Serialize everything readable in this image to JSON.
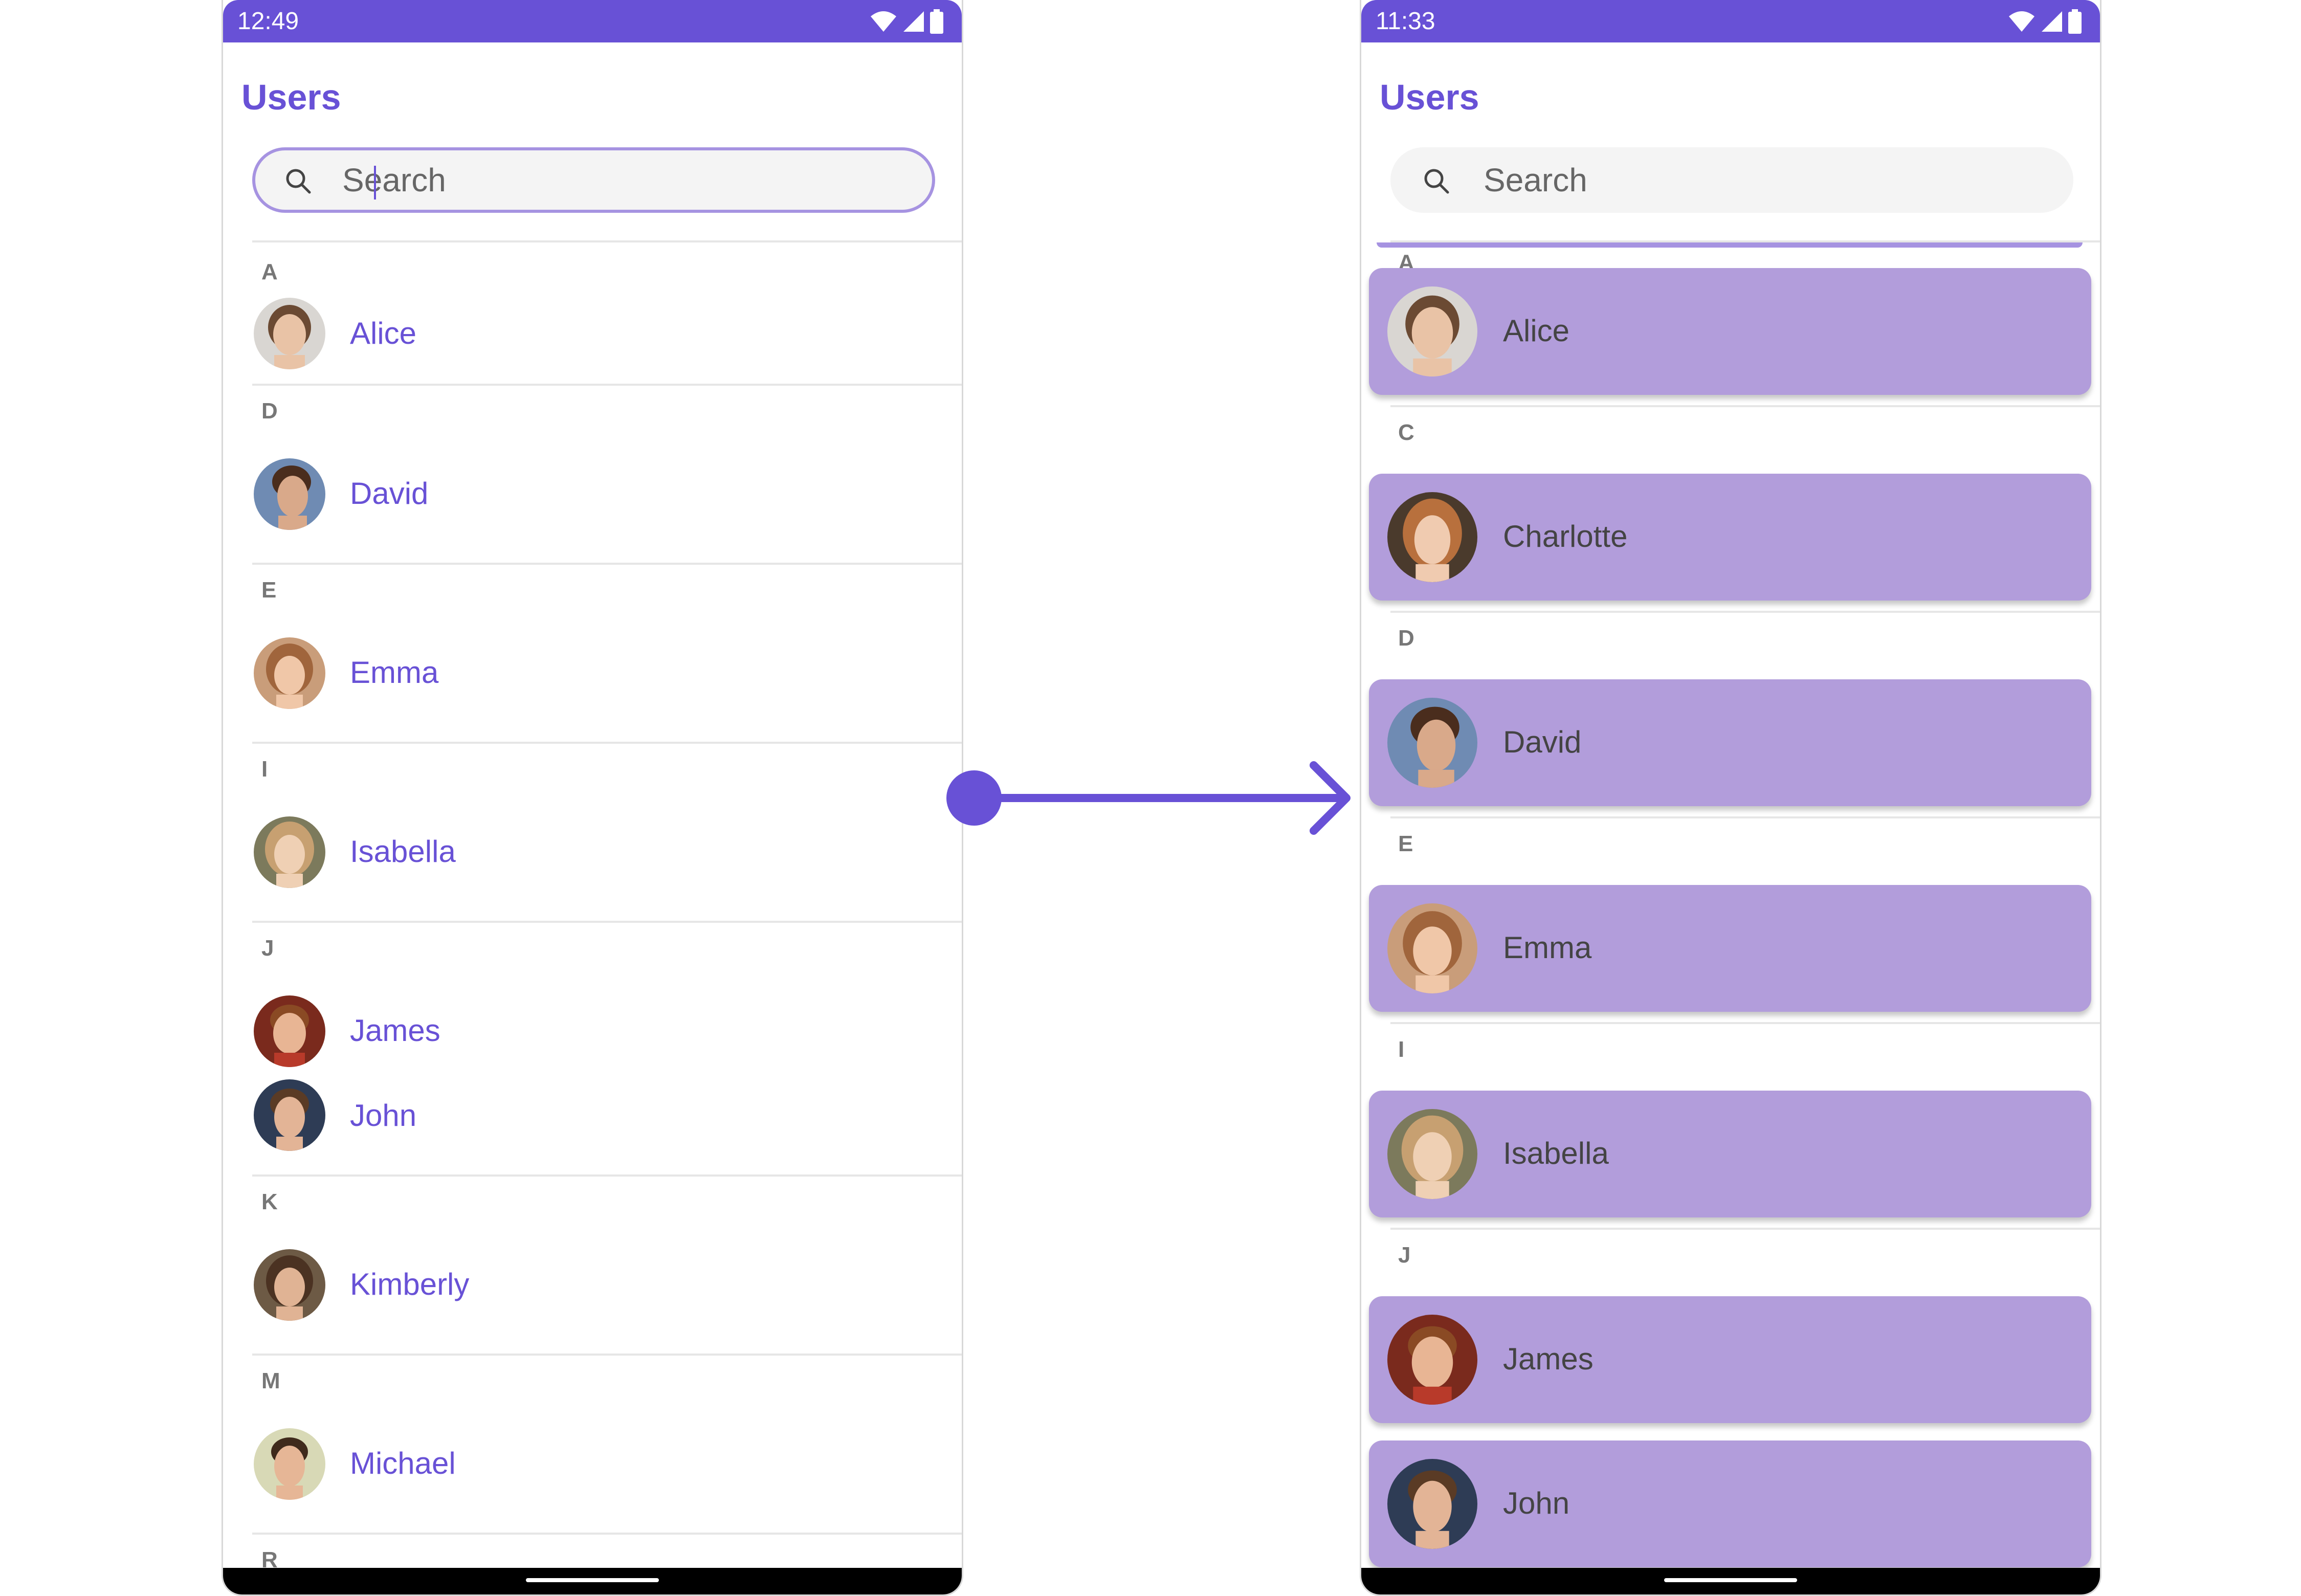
{
  "colors": {
    "accent": "#6851d6",
    "card": "#b29ddb",
    "divider": "#e6e6e6",
    "letter": "#777777"
  },
  "left_screen": {
    "status_time": "12:49",
    "title": "Users",
    "search": {
      "placeholder": "Search",
      "focused": true
    },
    "sections": [
      {
        "letter": "A",
        "users": [
          {
            "name": "Alice",
            "avatar": "avatar-alice"
          }
        ]
      },
      {
        "letter": "D",
        "users": [
          {
            "name": "David",
            "avatar": "avatar-david"
          }
        ]
      },
      {
        "letter": "E",
        "users": [
          {
            "name": "Emma",
            "avatar": "avatar-emma"
          }
        ]
      },
      {
        "letter": "I",
        "users": [
          {
            "name": "Isabella",
            "avatar": "avatar-isabella"
          }
        ]
      },
      {
        "letter": "J",
        "users": [
          {
            "name": "James",
            "avatar": "avatar-james"
          },
          {
            "name": "John",
            "avatar": "avatar-john"
          }
        ]
      },
      {
        "letter": "K",
        "users": [
          {
            "name": "Kimberly",
            "avatar": "avatar-kimberly"
          }
        ]
      },
      {
        "letter": "M",
        "users": [
          {
            "name": "Michael",
            "avatar": "avatar-michael"
          }
        ]
      },
      {
        "letter": "R",
        "users": []
      }
    ]
  },
  "right_screen": {
    "status_time": "11:33",
    "title": "Users",
    "search": {
      "placeholder": "Search",
      "focused": false
    },
    "sections": [
      {
        "letter": "A",
        "users": [
          {
            "name": "Alice",
            "avatar": "avatar-alice"
          }
        ]
      },
      {
        "letter": "C",
        "users": [
          {
            "name": "Charlotte",
            "avatar": "avatar-charlotte"
          }
        ]
      },
      {
        "letter": "D",
        "users": [
          {
            "name": "David",
            "avatar": "avatar-david"
          }
        ]
      },
      {
        "letter": "E",
        "users": [
          {
            "name": "Emma",
            "avatar": "avatar-emma"
          }
        ]
      },
      {
        "letter": "I",
        "users": [
          {
            "name": "Isabella",
            "avatar": "avatar-isabella"
          }
        ]
      },
      {
        "letter": "J",
        "users": [
          {
            "name": "James",
            "avatar": "avatar-james"
          },
          {
            "name": "John",
            "avatar": "avatar-john"
          }
        ]
      }
    ]
  },
  "icons": {
    "status": [
      "wifi-icon",
      "cell-signal-icon",
      "battery-icon"
    ],
    "search": "search-icon",
    "transition": "arrow-right-icon"
  }
}
